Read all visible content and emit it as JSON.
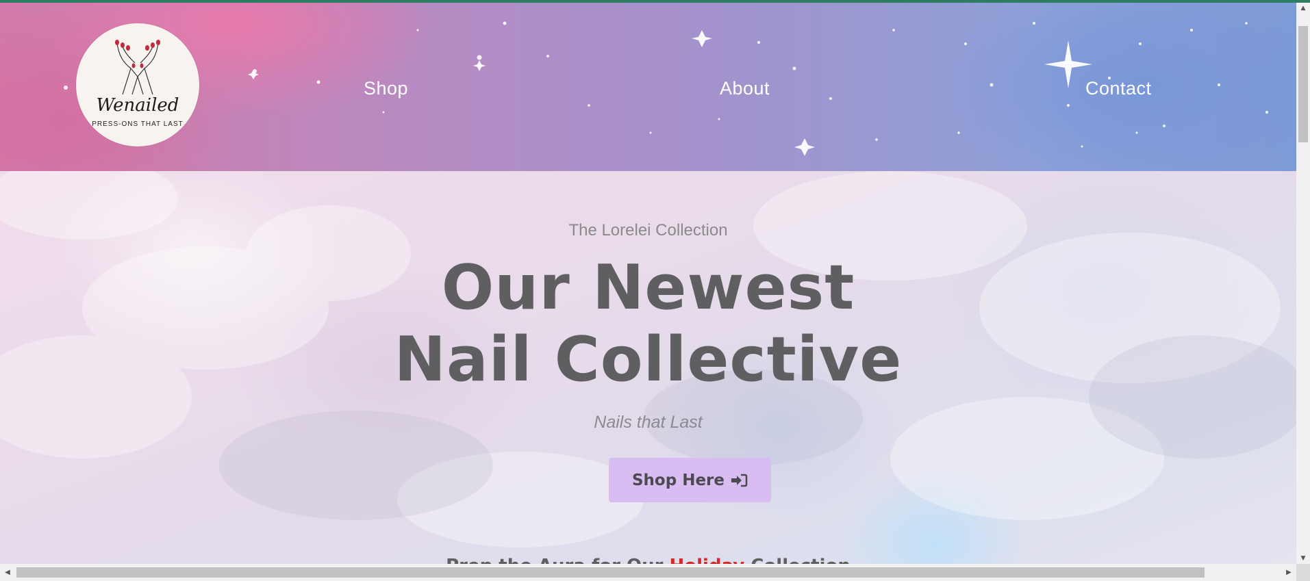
{
  "brand": {
    "name": "Wenailed",
    "tagline": "PRESS-ONS THAT LAST"
  },
  "nav": {
    "items": [
      {
        "label": "Shop"
      },
      {
        "label": "About"
      },
      {
        "label": "Contact"
      }
    ]
  },
  "hero": {
    "eyebrow": "The Lorelei Collection",
    "headline_line1": "Our Newest",
    "headline_line2": "Nail Collective",
    "tagline": "Nails that Last",
    "cta_label": "Shop Here",
    "cta_icon": "sign-in-icon",
    "bottom_prefix": "Prep the Aura for Our ",
    "bottom_highlight": "Holiday",
    "bottom_suffix": " Collection"
  },
  "colors": {
    "accent_bar": "#2e7d62",
    "cta_background": "#d9bdf2",
    "headline": "#5f5f61",
    "highlight": "#d02a2a"
  },
  "scrollbars": {
    "up": "▲",
    "down": "▼",
    "left": "◀",
    "right": "▶"
  }
}
